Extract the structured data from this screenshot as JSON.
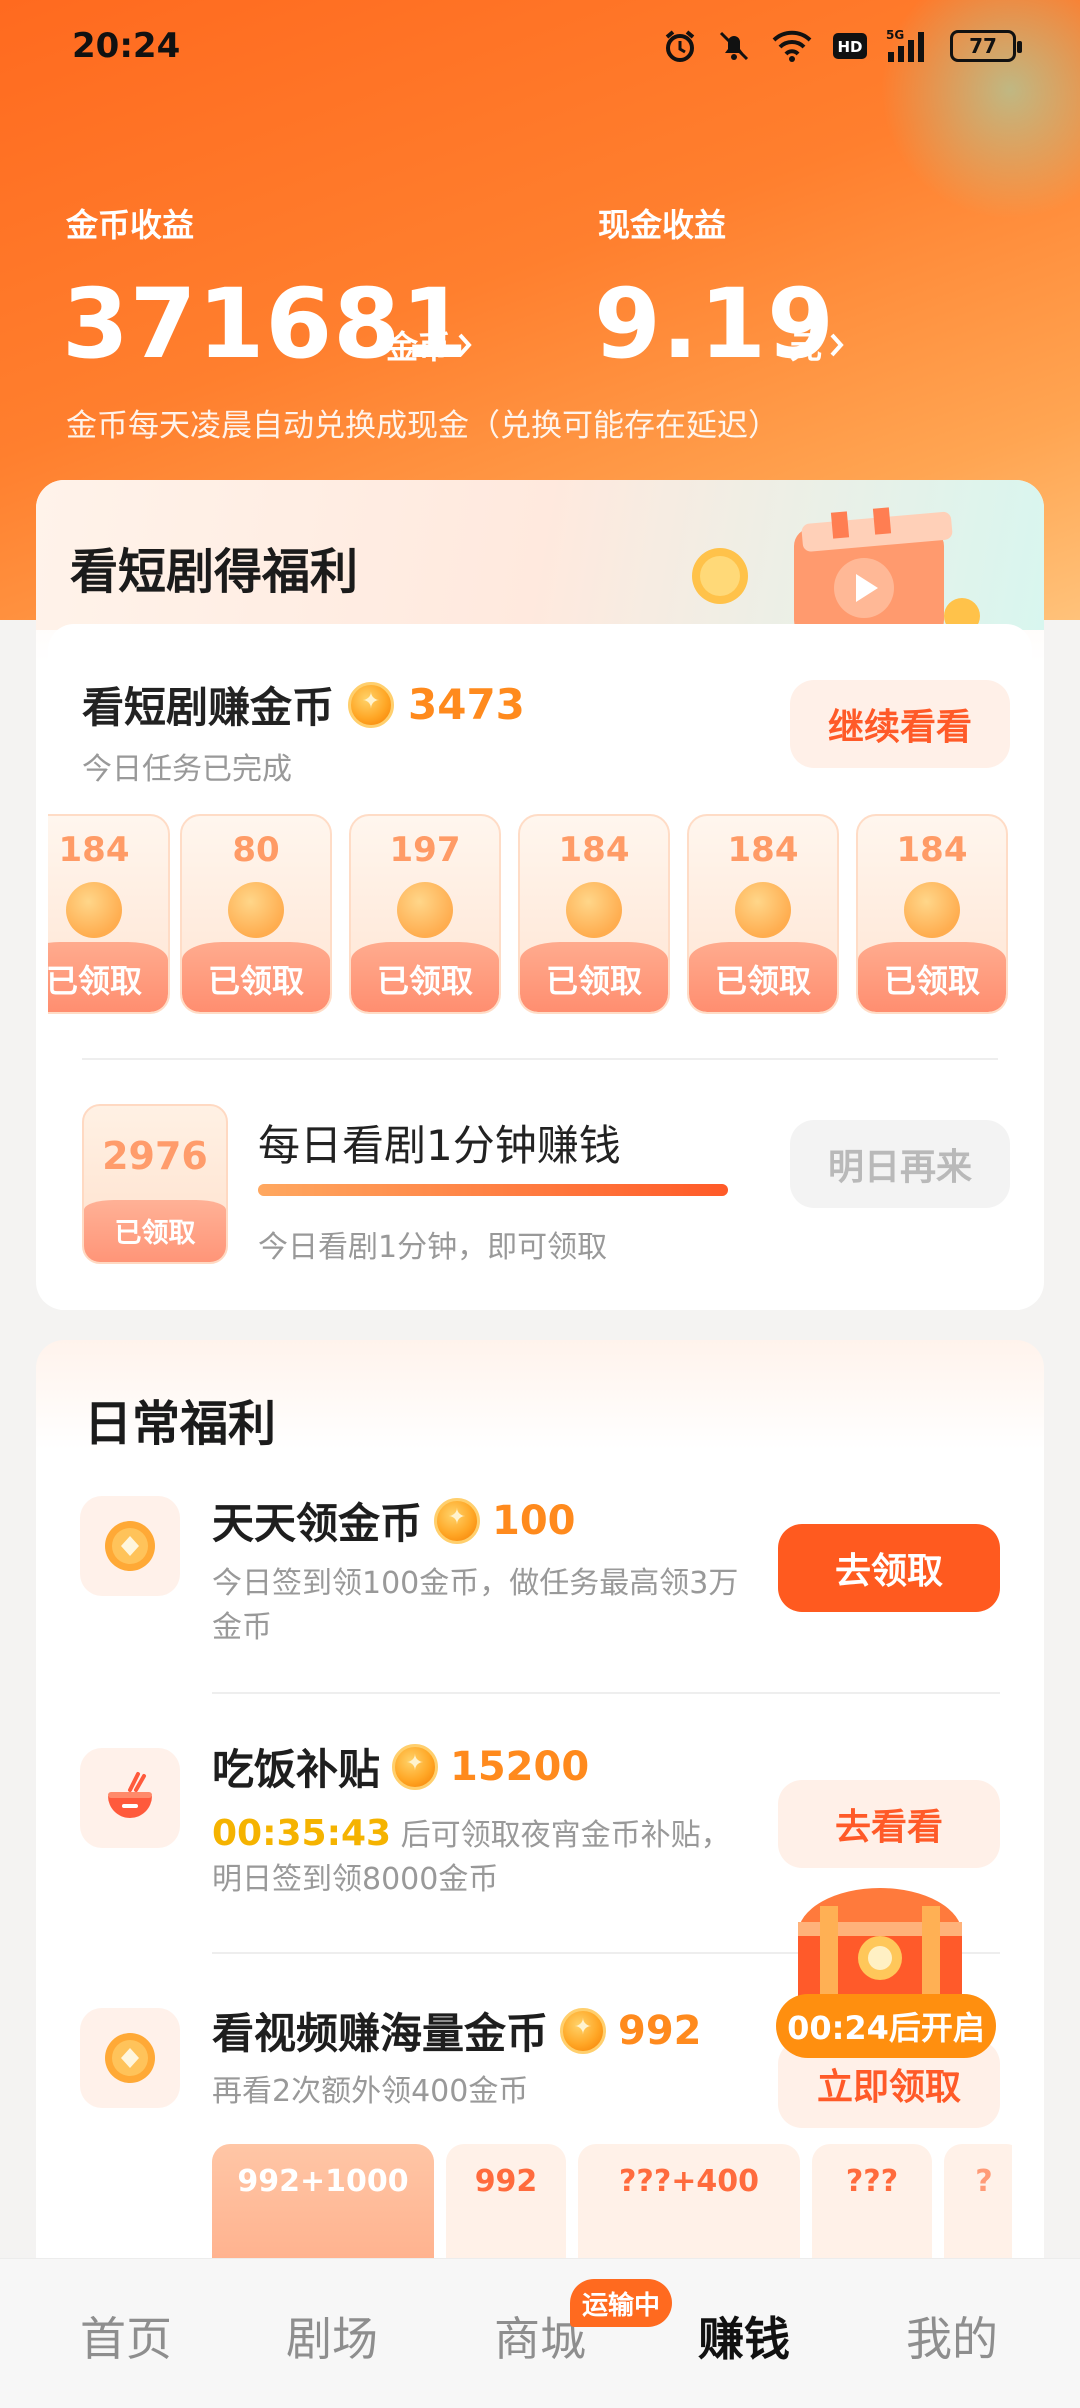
{
  "status_bar": {
    "time": "20:24",
    "battery": "77"
  },
  "earnings": {
    "coin_label": "金币收益",
    "coin_value": "371681",
    "coin_unit": "金币",
    "cash_label": "现金收益",
    "cash_value": "9.19",
    "cash_unit": "元",
    "note": "金币每天凌晨自动兑换成现金（兑换可能存在延迟）"
  },
  "drama_card": {
    "title": "看短剧得福利",
    "task_title": "看短剧赚金币",
    "task_amount": "3473",
    "task_sub": "今日任务已完成",
    "continue_button": "继续看看",
    "rewards": [
      {
        "value": "184",
        "status": "已领取"
      },
      {
        "value": "80",
        "status": "已领取"
      },
      {
        "value": "197",
        "status": "已领取"
      },
      {
        "value": "184",
        "status": "已领取"
      },
      {
        "value": "184",
        "status": "已领取"
      },
      {
        "value": "184",
        "status": "已领取"
      }
    ],
    "daily_box_value": "2976",
    "daily_box_status": "已领取",
    "daily_title": "每日看剧1分钟赚钱",
    "daily_progress": 1.0,
    "daily_sub": "今日看剧1分钟，即可领取",
    "tomorrow_button": "明日再来"
  },
  "daily_card": {
    "title": "日常福利",
    "tasks": [
      {
        "title": "天天领金币",
        "amount": "100",
        "desc": "今日签到领100金币，做任务最高领3万金币",
        "button": "去领取"
      },
      {
        "title": "吃饭补贴",
        "amount": "15200",
        "timer": "00:35:43",
        "desc": "后可领取夜宵金币补贴，明日签到领8000金币",
        "button": "去看看"
      },
      {
        "title": "看视频赚海量金币",
        "amount": "992",
        "desc": "再看2次额外领400金币",
        "button": "立即领取"
      }
    ],
    "video_tiles": [
      "992+1000",
      "992",
      "???+400",
      "???",
      "?"
    ]
  },
  "chest": {
    "timer": "00:24后开启"
  },
  "tabbar": {
    "tabs": [
      "首页",
      "剧场",
      "商城",
      "赚钱",
      "我的"
    ],
    "active": "赚钱",
    "badge": "运输中"
  },
  "colors": {
    "accent": "#ff5a1f",
    "coin": "#ff8a1d",
    "timer": "#f5b300"
  }
}
